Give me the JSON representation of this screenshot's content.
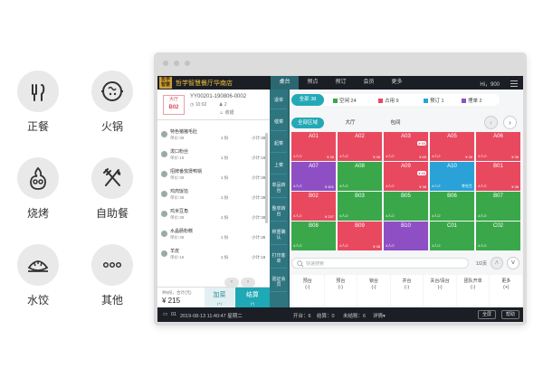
{
  "categories": [
    {
      "label": "正餐",
      "icon": "headphone-chopsticks-icon"
    },
    {
      "label": "火锅",
      "icon": "hotpot-icon"
    },
    {
      "label": "烧烤",
      "icon": "grill-icon"
    },
    {
      "label": "自助餐",
      "icon": "fork-knife-icon"
    },
    {
      "label": "水饺",
      "icon": "dumpling-icon"
    },
    {
      "label": "其他",
      "icon": "more-dots-icon"
    }
  ],
  "header": {
    "brand": "哲学智慧餐厅华南店",
    "nav": [
      "桌台",
      "预点",
      "预订",
      "会员",
      "更多"
    ],
    "user": "Hi，900"
  },
  "order": {
    "area": "大厅",
    "table": "B02",
    "order_no": "YY00201-190806-0002",
    "time": "10:02",
    "guests": "2",
    "waiter": "收银",
    "items": [
      {
        "name": "特色猪猪毛肚",
        "price": "单价:38",
        "qty": "1 份",
        "subtotal": "小计:38"
      },
      {
        "name": "泼口粉丝",
        "price": "单价:18",
        "qty": "1 份",
        "subtotal": "小计:18"
      },
      {
        "name": "招牌番茄煲鸭锅",
        "price": "单价:38",
        "qty": "1 份",
        "subtotal": "小计:38"
      },
      {
        "name": "鸡肉饭馅",
        "price": "单价:38",
        "qty": "1 份",
        "subtotal": "小计:38"
      },
      {
        "name": "鸡米豆角",
        "price": "单价:38",
        "qty": "1 份",
        "subtotal": "小计:38"
      },
      {
        "name": "水晶肠粉糕",
        "price": "单价:38",
        "qty": "1 份",
        "subtotal": "小计:38"
      },
      {
        "name": "羊皮",
        "price": "单价:18",
        "qty": "1 份",
        "subtotal": "小计:18"
      }
    ],
    "total_label": "共5份，合计(元)",
    "total": "¥ 215",
    "add_label": "加菜",
    "add_sub": "(+)",
    "pay_label": "结算",
    "pay_sub": "(*)",
    "pager_prev": "‹",
    "pager_next": "›"
  },
  "side_buttons": [
    "退单",
    "催菜",
    "起菜",
    "上菜",
    "单品转台",
    "整单转台",
    "称重确认",
    "打印客单",
    "验证会员"
  ],
  "stats": {
    "all": "全部 38",
    "free": "空闲 24",
    "occupied": "占用 9",
    "reserved": "预订 1",
    "pending": "埋单 2",
    "colors": {
      "free": "#3aa84a",
      "occupied": "#e8495f",
      "reserved": "#2aa2d8",
      "pending": "#8e4fc4"
    }
  },
  "areas": [
    "全部区域",
    "大厅",
    "包间"
  ],
  "tables": [
    {
      "no": "A01",
      "state": "occupied",
      "seat": "4人/2",
      "amount": "¥ 38"
    },
    {
      "no": "A02",
      "state": "occupied",
      "seat": "4人/2",
      "amount": "¥ 38"
    },
    {
      "no": "A03",
      "state": "occupied",
      "seat": "4人/2",
      "amount": "¥ 65",
      "tag": "¥ 65"
    },
    {
      "no": "A05",
      "state": "occupied",
      "seat": "4人/2",
      "amount": "¥ 38"
    },
    {
      "no": "A06",
      "state": "occupied",
      "seat": "4人/2",
      "amount": "¥ 38"
    },
    {
      "no": "A07",
      "state": "pending",
      "seat": "4人/2",
      "amount": "¥ 401"
    },
    {
      "no": "A08",
      "state": "free",
      "seat": "4人/2",
      "amount": ""
    },
    {
      "no": "A09",
      "state": "occupied",
      "seat": "4人/2",
      "amount": "¥ 38",
      "tag": "¥ 65"
    },
    {
      "no": "A10",
      "state": "reserved",
      "seat": "4人/2",
      "amount": "李先生"
    },
    {
      "no": "B01",
      "state": "occupied",
      "seat": "4人/2",
      "amount": "¥ 38"
    },
    {
      "no": "B02",
      "state": "occupied",
      "seat": "4人/2",
      "amount": "¥ 237"
    },
    {
      "no": "B03",
      "state": "free",
      "seat": "4人/2",
      "amount": ""
    },
    {
      "no": "B05",
      "state": "free",
      "seat": "4人/2",
      "amount": ""
    },
    {
      "no": "B06",
      "state": "free",
      "seat": "4人/2",
      "amount": ""
    },
    {
      "no": "B07",
      "state": "free",
      "seat": "4人/2",
      "amount": ""
    },
    {
      "no": "B08",
      "state": "free",
      "seat": "4人/2",
      "amount": ""
    },
    {
      "no": "B09",
      "state": "occupied",
      "seat": "4人/2",
      "amount": "¥ 38"
    },
    {
      "no": "B10",
      "state": "pending",
      "seat": "4人/2",
      "amount": ""
    },
    {
      "no": "C01",
      "state": "free",
      "seat": "4人/2",
      "amount": ""
    },
    {
      "no": "C02",
      "state": "free",
      "seat": "4人/2",
      "amount": ""
    }
  ],
  "search_placeholder": "快速搜索",
  "page_info": "1/2页",
  "ops": [
    "预台\n(-)",
    "预台\n(-)",
    "锁台\n(-)",
    "并台\n(-)",
    "关台/清台\n(-)",
    "团队开单\n(-)",
    "更多\n(+)"
  ],
  "status": {
    "version": "01",
    "datetime": "2019-08-13 11:40:47 星期二",
    "open": "开台：6",
    "settled": "结算：0",
    "unsettled": "未结账：6",
    "detail": "详情▾",
    "fullscreen": "全屏",
    "help": "帮助"
  }
}
